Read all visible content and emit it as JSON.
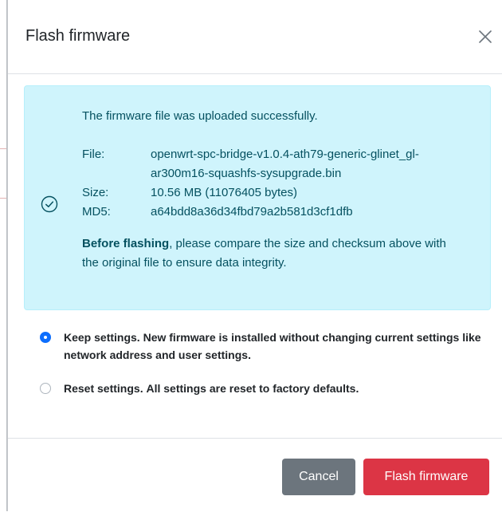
{
  "background": {
    "partial_text": "... ..."
  },
  "modal": {
    "title": "Flash firmware",
    "close_icon": "close-icon",
    "alert": {
      "icon": "check-circle-icon",
      "message": "The firmware file was uploaded successfully.",
      "file_label": "File:",
      "file_value": "openwrt-spc-bridge-v1.0.4-ath79-generic-glinet_gl-ar300m16-squashfs-sysupgrade.bin",
      "size_label": "Size:",
      "size_value": "10.56 MB (11076405 bytes)",
      "md5_label": "MD5:",
      "md5_value": "a64bdd8a36d34fbd79a2b581d3cf1dfb",
      "note_bold": "Before flashing",
      "note_rest": ", please compare the size and checksum above with the original file to ensure data integrity."
    },
    "options": [
      {
        "checked": true,
        "title": "Keep settings.",
        "description": "New firmware is installed without changing current settings like network address and user settings."
      },
      {
        "checked": false,
        "title": "Reset settings.",
        "description": "All settings are reset to factory defaults."
      }
    ],
    "buttons": {
      "cancel_label": "Cancel",
      "flash_label": "Flash firmware"
    }
  },
  "colors": {
    "alert_bg": "#cff4fc",
    "alert_text": "#055160",
    "primary": "#0d6efd",
    "danger": "#dc3545",
    "secondary": "#6c757d"
  }
}
